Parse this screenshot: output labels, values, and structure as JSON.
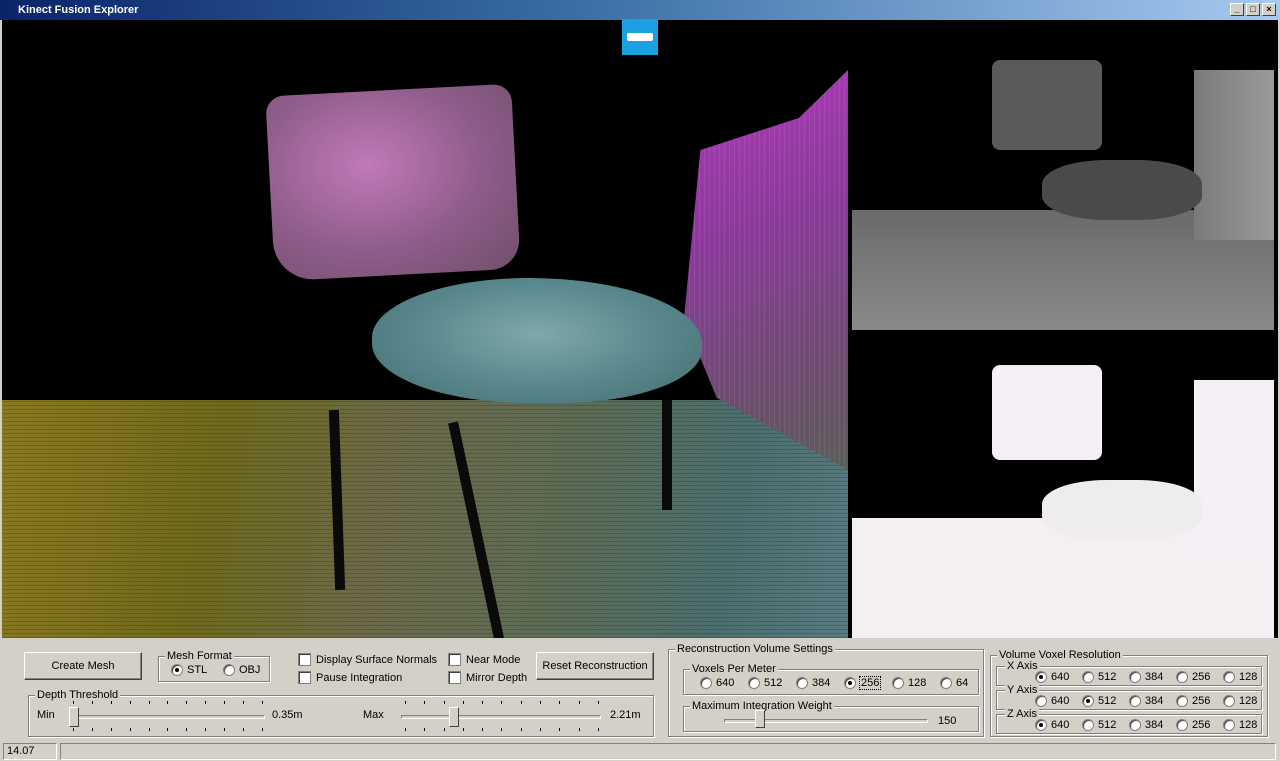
{
  "window": {
    "title": "Kinect Fusion Explorer",
    "controls": [
      "_",
      "□",
      "×"
    ]
  },
  "icons": {
    "kinect": "kinect-sensor-icon"
  },
  "buttons": {
    "create_mesh": "Create Mesh",
    "reset_reconstruction": "Reset Reconstruction"
  },
  "mesh_format": {
    "label": "Mesh Format",
    "options": [
      {
        "label": "STL",
        "selected": true
      },
      {
        "label": "OBJ",
        "selected": false
      }
    ]
  },
  "checkboxes": {
    "display_surface_normals": "Display Surface Normals",
    "pause_integration": "Pause Integration",
    "near_mode": "Near Mode",
    "mirror_depth": "Mirror Depth"
  },
  "depth_threshold": {
    "label": "Depth Threshold",
    "min_label": "Min",
    "min_value": "0.35m",
    "min_fraction": 0.0,
    "max_label": "Max",
    "max_value": "2.21m",
    "max_fraction": 0.25
  },
  "reconstruction": {
    "label": "Reconstruction Volume Settings",
    "voxels_per_meter": {
      "label": "Voxels Per Meter",
      "options": [
        "640",
        "512",
        "384",
        "256",
        "128",
        "64"
      ],
      "selected": "256"
    },
    "max_integration_weight": {
      "label": "Maximum Integration Weight",
      "value": "150",
      "fraction": 0.16
    }
  },
  "voxel_resolution": {
    "label": "Volume Voxel Resolution",
    "options": [
      "640",
      "512",
      "384",
      "256",
      "128"
    ],
    "axes": [
      {
        "label": "X Axis",
        "selected": "640"
      },
      {
        "label": "Y Axis",
        "selected": "512"
      },
      {
        "label": "Z Axis",
        "selected": "640"
      }
    ]
  },
  "status": {
    "fps": "14.07 FPS",
    "message": ""
  }
}
